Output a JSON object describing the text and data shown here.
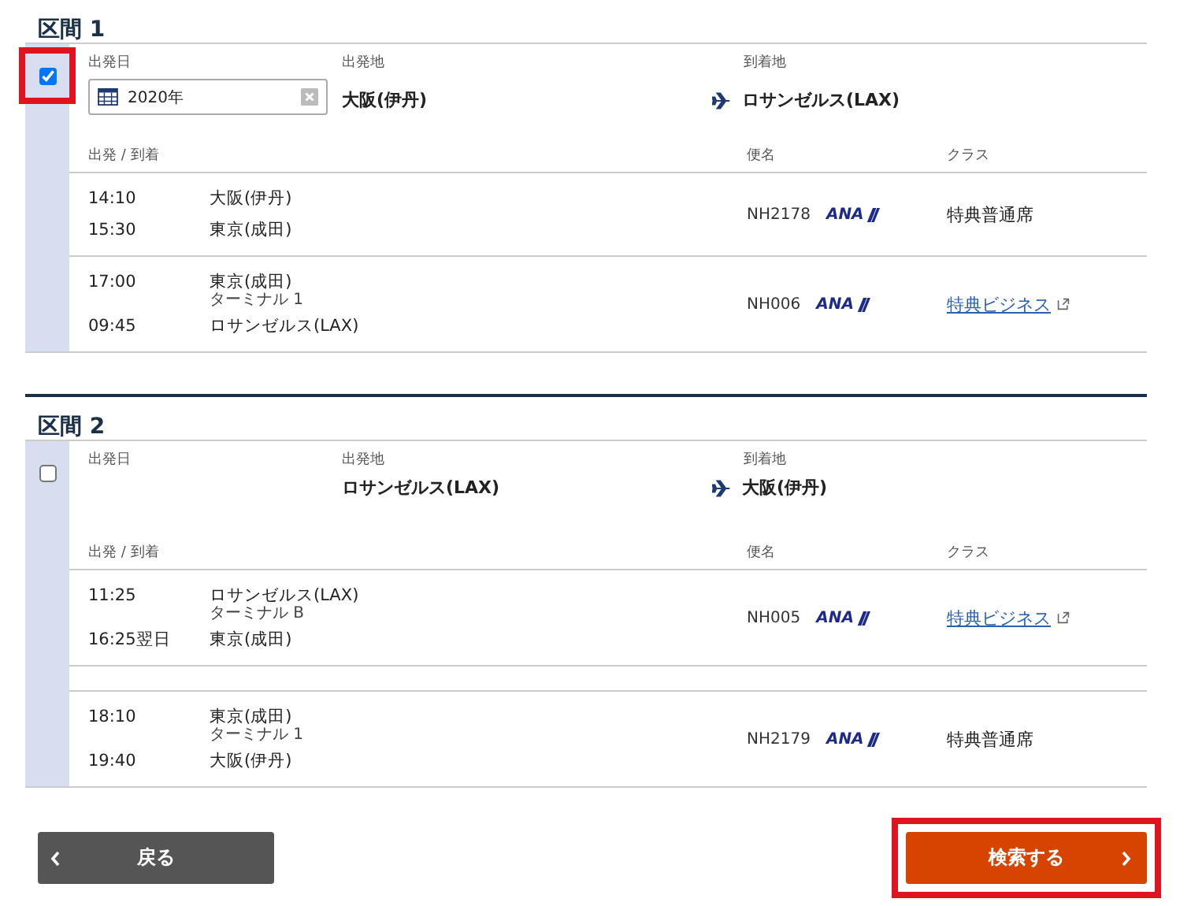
{
  "segments": [
    {
      "title": "区間 1",
      "selected": true,
      "highlighted": true,
      "date_label": "出発日",
      "date_field": {
        "value": "2020年"
      },
      "origin_label": "出発地",
      "origin": "大阪(伊丹)",
      "destination_label": "到着地",
      "destination": "ロサンゼルス(LAX)",
      "columns": [
        "出発 / 到着",
        "便名",
        "クラス"
      ],
      "legs": [
        {
          "gap_before": false,
          "dep_time": "14:10",
          "dep_place": "大阪(伊丹)",
          "arr_time": "15:30",
          "arr_place": "東京(成田)",
          "flight": "NH2178",
          "airline": "ANA",
          "class": "特典普通席",
          "kind": "text"
        },
        {
          "gap_before": false,
          "dep_time": "17:00",
          "dep_place": "東京(成田)",
          "dep_terminal": "ターミナル 1",
          "arr_time": "09:45",
          "arr_place": "ロサンゼルス(LAX)",
          "flight": "NH006",
          "airline": "ANA",
          "class": "特典ビジネス",
          "kind": "link"
        }
      ]
    },
    {
      "title": "区間 2",
      "selected": false,
      "highlighted": false,
      "date_label": "出発日",
      "origin_label": "出発地",
      "origin": "ロサンゼルス(LAX)",
      "destination_label": "到着地",
      "destination": "大阪(伊丹)",
      "columns": [
        "出発 / 到着",
        "便名",
        "クラス"
      ],
      "legs": [
        {
          "gap_before": false,
          "dep_time": "11:25",
          "dep_place": "ロサンゼルス(LAX)",
          "dep_terminal": "ターミナル B",
          "arr_time": "16:25翌日",
          "arr_place": "東京(成田)",
          "flight": "NH005",
          "airline": "ANA",
          "class": "特典ビジネス",
          "kind": "link"
        },
        {
          "gap_before": true,
          "dep_time": "18:10",
          "dep_place": "東京(成田)",
          "dep_terminal": "ターミナル 1",
          "arr_time": "19:40",
          "arr_place": "大阪(伊丹)",
          "flight": "NH2179",
          "airline": "ANA",
          "class": "特典普通席",
          "kind": "text"
        }
      ]
    }
  ],
  "back_button": {
    "label": "戻る"
  },
  "search_button": {
    "label": "検索する",
    "highlighted": true
  }
}
